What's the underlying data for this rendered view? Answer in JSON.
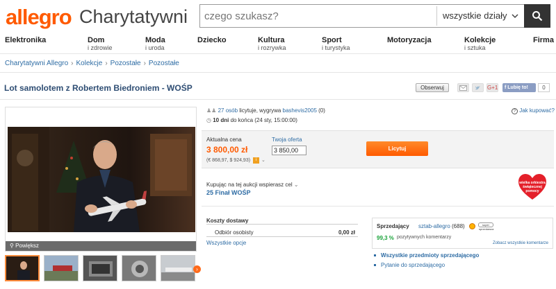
{
  "header": {
    "logo": "allegro",
    "logo_sub": "Charytatywni",
    "search_placeholder": "czego szukasz?",
    "search_category": "wszystkie działy"
  },
  "nav": [
    {
      "main": "Elektronika",
      "sub": ""
    },
    {
      "main": "Dom",
      "sub": "i zdrowie"
    },
    {
      "main": "Moda",
      "sub": "i uroda"
    },
    {
      "main": "Dziecko",
      "sub": ""
    },
    {
      "main": "Kultura",
      "sub": "i rozrywka"
    },
    {
      "main": "Sport",
      "sub": "i turystyka"
    },
    {
      "main": "Motoryzacja",
      "sub": ""
    },
    {
      "main": "Kolekcje",
      "sub": "i sztuka"
    },
    {
      "main": "Firma",
      "sub": ""
    }
  ],
  "breadcrumb": [
    "Charytatywni Allegro",
    "Kolekcje",
    "Pozostałe",
    "Pozostałe"
  ],
  "title": "Lot samolotem z Robertem Biedroniem - WOŚP",
  "actions": {
    "observe": "Obserwuj",
    "gplus": "G+1",
    "fb_like": "Lubię to!",
    "fb_count": "0"
  },
  "photo": {
    "zoom_label": "Powiększ"
  },
  "auction": {
    "bidders_link": "27 osób",
    "bidders_text": "licytuje, wygrywa",
    "winner": "bashevis2005",
    "winner_score": "(0)",
    "ends_bold": "10 dni",
    "ends_text": "do końca (24 sty, 15:00:00)",
    "help": "Jak kupować?",
    "current_price_label": "Aktualna cena",
    "current_price": "3 800,00 zł",
    "price_conversion": "(€ 868,97, $ 924,93)",
    "your_offer_label": "Twoja oferta",
    "your_offer_value": "3 850,00",
    "bid_button": "Licytuj"
  },
  "charity": {
    "text": "Kupując na tej aukcji wspierasz cel",
    "link": "25 Finał WOŚP",
    "heart_text": "wielka orkiestra świątecznej pomocy"
  },
  "shipping": {
    "title": "Koszty dostawy",
    "option_name": "Odbiór osobisty",
    "option_price": "0,00 zł",
    "all_options": "Wszystkie opcje"
  },
  "seller": {
    "label": "Sprzedający",
    "name": "sztab-allegro",
    "count": "(688)",
    "badge": "super sprzedawca",
    "positive_pct": "99,3 %",
    "positive_text": "pozytywnych komentarzy",
    "all_comments": "Zobacz wszystkie komentarze",
    "all_items": "Wszystkie przedmioty sprzedającego",
    "ask": "Pytanie do sprzedającego"
  },
  "colors": {
    "brand": "#ff5a00",
    "link": "#2e6ca4",
    "title": "#2e4d73",
    "positive": "#1aa33a"
  }
}
